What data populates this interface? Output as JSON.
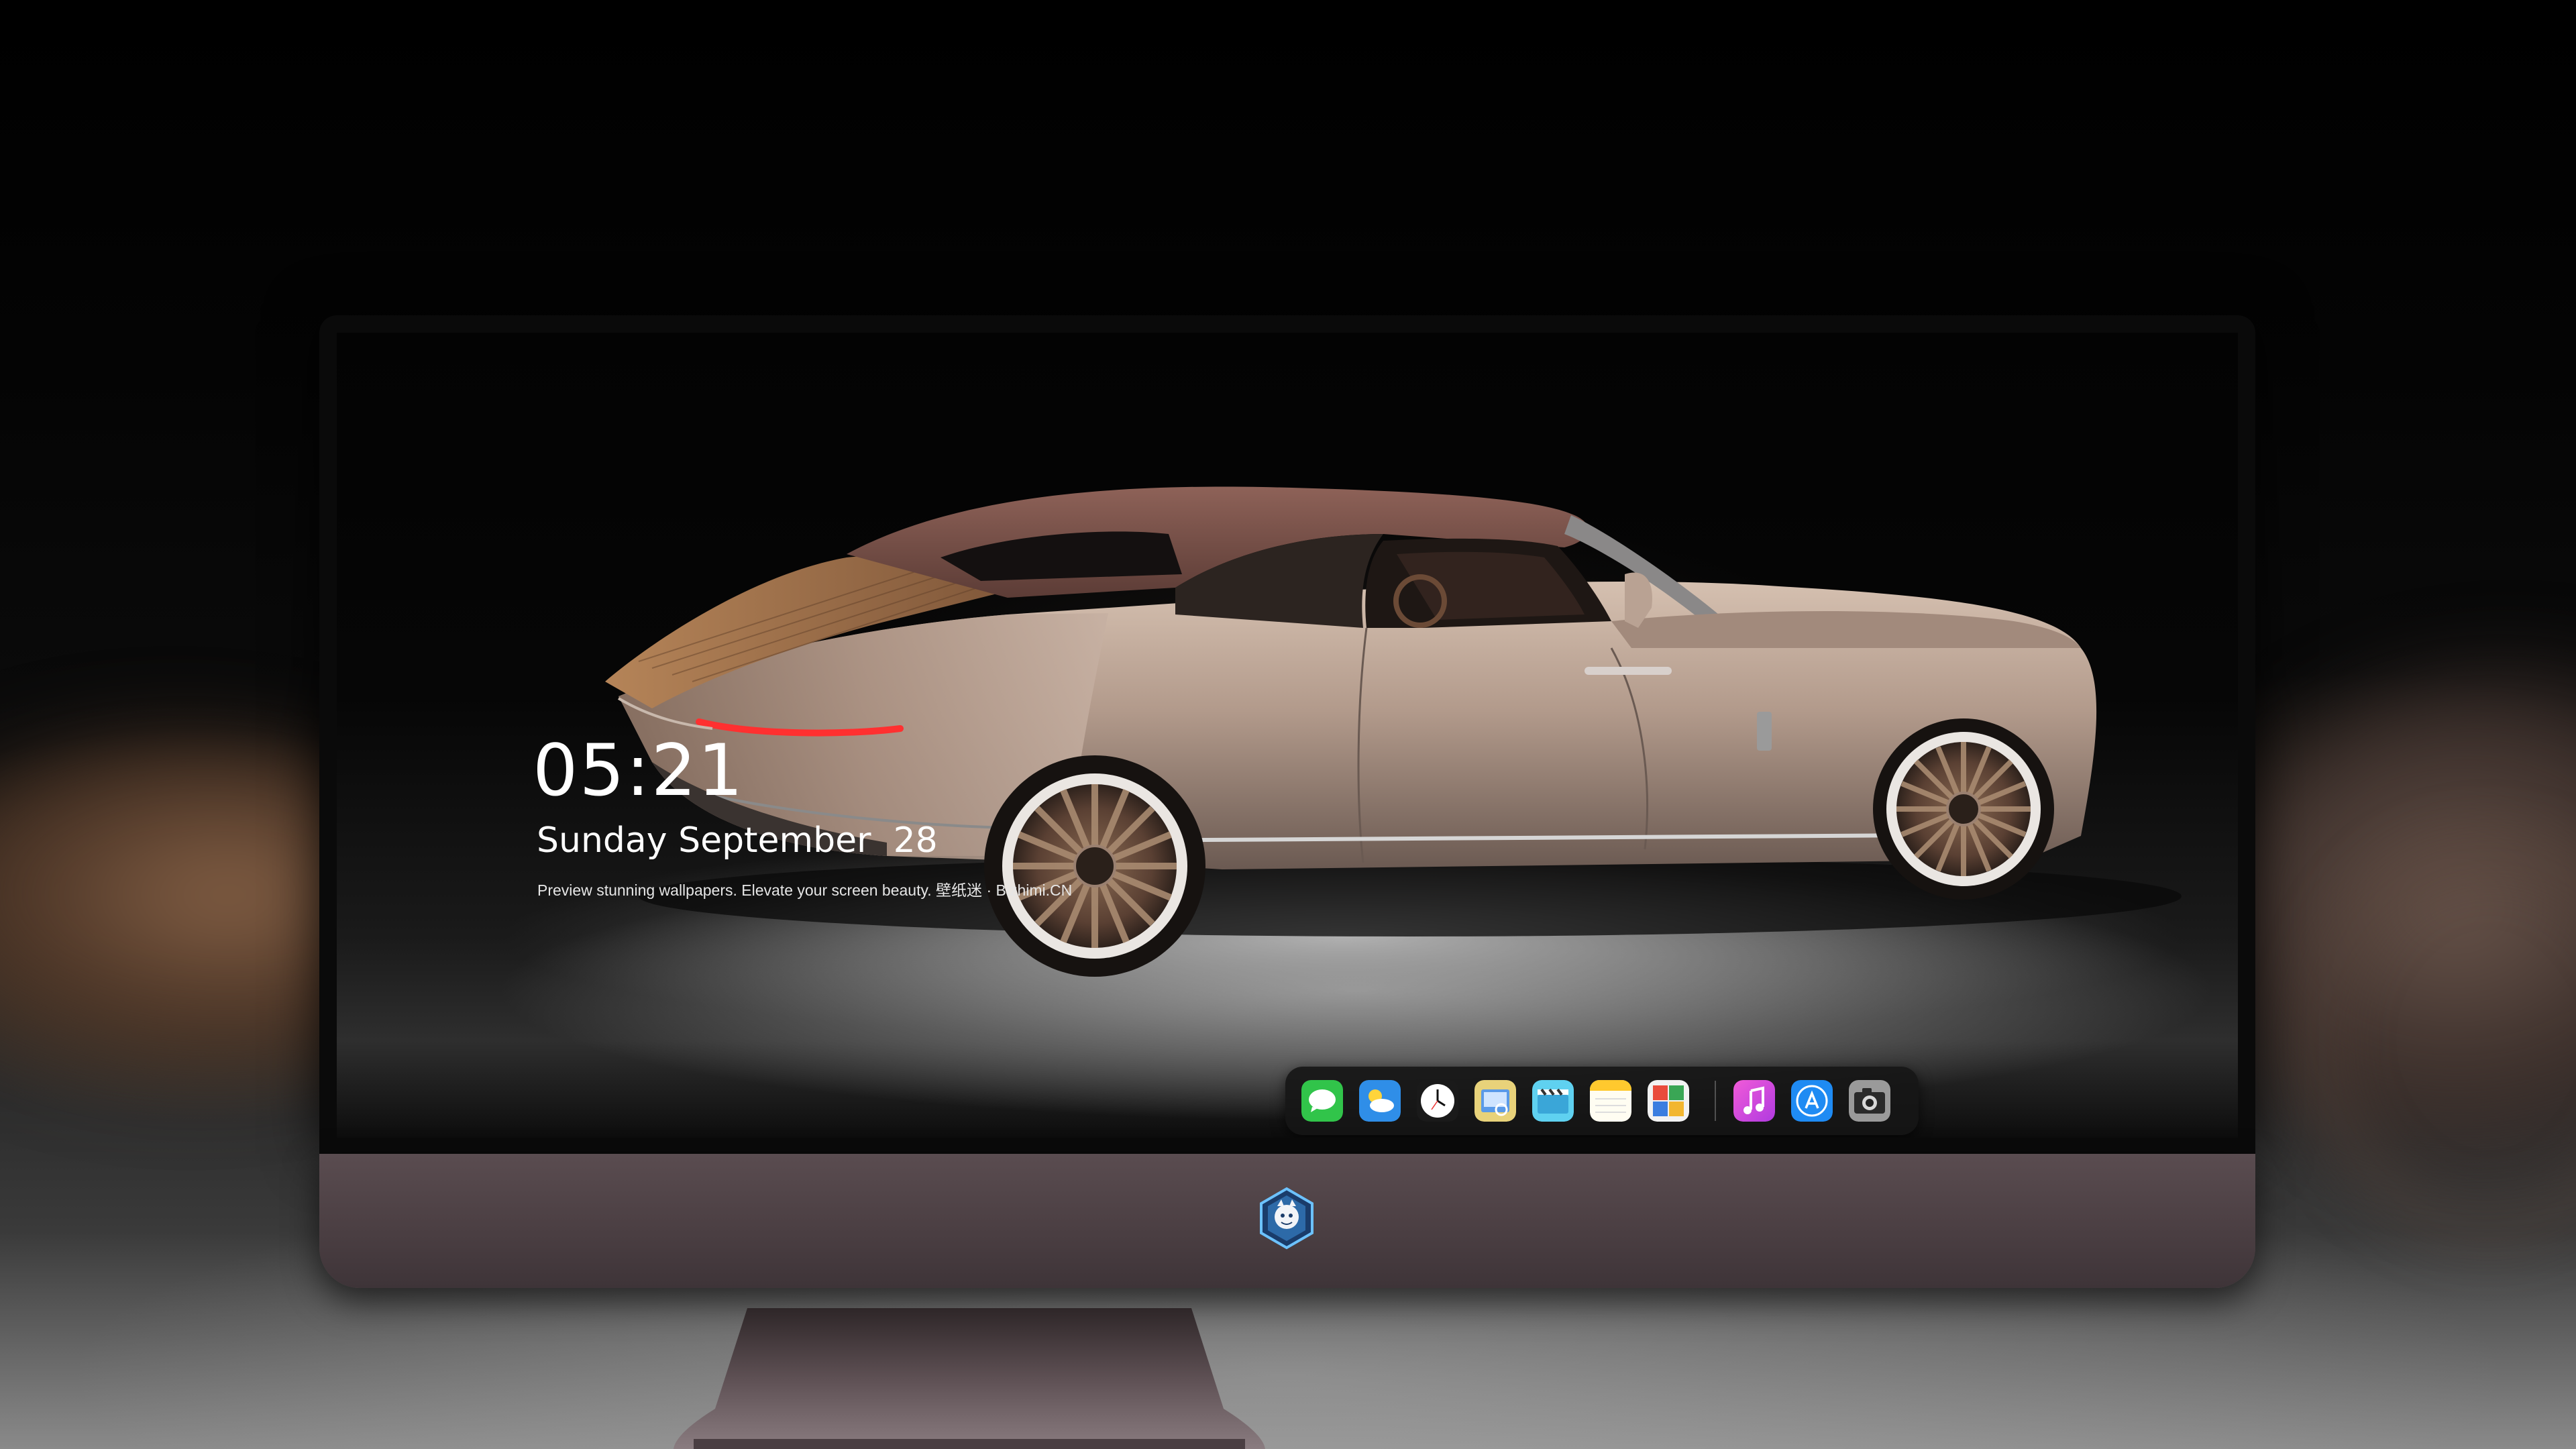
{
  "lockscreen": {
    "time": "05:21",
    "date": "Sunday September  28",
    "tagline": "Preview stunning wallpapers. Elevate your screen beauty. 壁纸迷 · Bizhimi.CN"
  },
  "dock": {
    "apps": [
      {
        "name": "messages-icon"
      },
      {
        "name": "weather-icon"
      },
      {
        "name": "clock-icon"
      },
      {
        "name": "preview-icon"
      },
      {
        "name": "clips-icon"
      },
      {
        "name": "notes-icon"
      },
      {
        "name": "photo-booth-icon"
      },
      {
        "name": "itunes-icon"
      },
      {
        "name": "app-store-icon"
      },
      {
        "name": "camera-icon"
      }
    ]
  },
  "colors": {
    "car_body": "#b39c8e",
    "car_roof": "#7a5148",
    "deck_wood": "#9a6a44",
    "monitor_chin": "#4e4246"
  }
}
